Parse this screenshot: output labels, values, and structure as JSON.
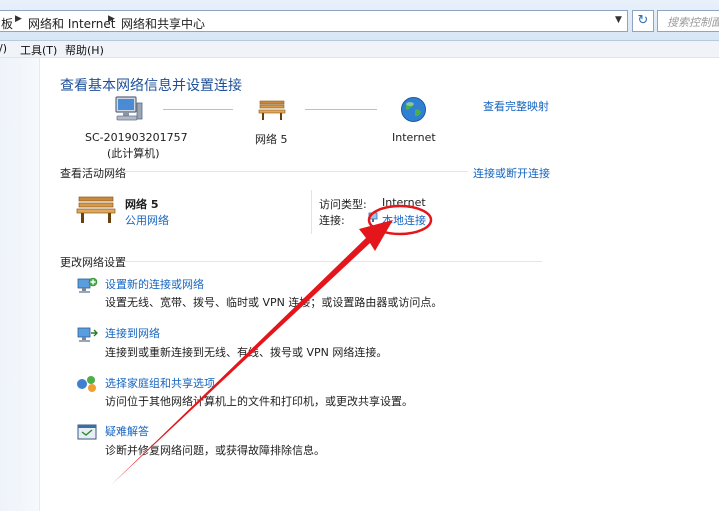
{
  "address": {
    "crumbs": [
      "板",
      "网络和 Internet",
      "网络和共享中心"
    ],
    "search_placeholder": "搜索控制面板"
  },
  "menu": {
    "view_fragment": "/)",
    "tools": "工具(T)",
    "help": "帮助(H)"
  },
  "main": {
    "title": "查看基本网络信息并设置连接",
    "view_full_map": "查看完整映射",
    "map": {
      "computer_name": "SC-201903201757",
      "computer_sub": "(此计算机)",
      "network_name": "网络  5",
      "internet": "Internet"
    },
    "active_networks_heading": "查看活动网络",
    "connect_disconnect": "连接或断开连接",
    "active_network": {
      "name": "网络  5",
      "type": "公用网络",
      "access_type_label": "访问类型:",
      "access_type_value": "Internet",
      "connections_label": "连接:",
      "connections_value": "本地连接"
    },
    "change_settings_heading": "更改网络设置",
    "tasks": [
      {
        "title": "设置新的连接或网络",
        "desc": "设置无线、宽带、拨号、临时或 VPN 连接；或设置路由器或访问点。",
        "icon": "network-setup-icon"
      },
      {
        "title": "连接到网络",
        "desc": "连接到或重新连接到无线、有线、拨号或 VPN 网络连接。",
        "icon": "connect-network-icon"
      },
      {
        "title": "选择家庭组和共享选项",
        "desc": "访问位于其他网络计算机上的文件和打印机，或更改共享设置。",
        "icon": "homegroup-icon"
      },
      {
        "title": "疑难解答",
        "desc": "诊断并修复网络问题，或获得故障排除信息。",
        "icon": "troubleshoot-icon"
      }
    ]
  },
  "colors": {
    "link": "#1665c1",
    "title": "#1e4f9a",
    "annotation_red": "#e4161b"
  }
}
